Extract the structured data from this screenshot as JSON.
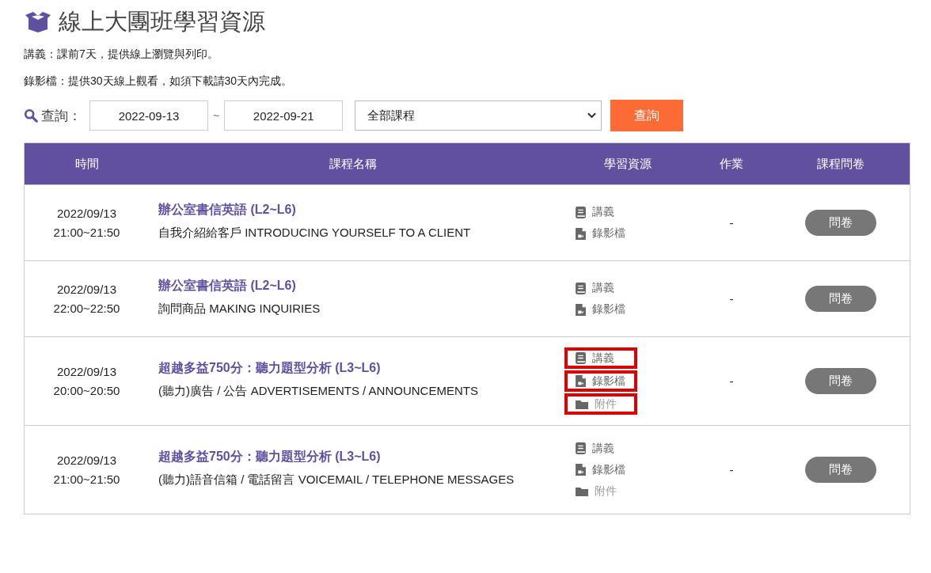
{
  "page": {
    "title": "線上大團班學習資源",
    "notes": [
      "講義：課前7天，提供線上瀏覽與列印。",
      "錄影檔：提供30天線上觀看，如須下載請30天內完成。"
    ]
  },
  "search": {
    "label": "查詢：",
    "date_from": "2022-09-13",
    "separator": "~",
    "date_to": "2022-09-21",
    "course_select": "全部課程",
    "button": "查詢"
  },
  "table": {
    "columns": [
      "時間",
      "課程名稱",
      "學習資源",
      "作業",
      "課程問卷"
    ],
    "rows": [
      {
        "date": "2022/09/13",
        "time": "21:00~21:50",
        "course": "辦公室書信英語 (L2~L6)",
        "lesson": "自我介紹給客戶 INTRODUCING YOURSELF TO A CLIENT",
        "resources": [
          {
            "kind": "handout",
            "label": "講義",
            "highlighted": false
          },
          {
            "kind": "video",
            "label": "錄影檔",
            "highlighted": false
          }
        ],
        "homework": "-",
        "survey": "問卷"
      },
      {
        "date": "2022/09/13",
        "time": "22:00~22:50",
        "course": "辦公室書信英語 (L2~L6)",
        "lesson": "詢問商品 MAKING INQUIRIES",
        "resources": [
          {
            "kind": "handout",
            "label": "講義",
            "highlighted": false
          },
          {
            "kind": "video",
            "label": "錄影檔",
            "highlighted": false
          }
        ],
        "homework": "-",
        "survey": "問卷"
      },
      {
        "date": "2022/09/13",
        "time": "20:00~20:50",
        "course": "超越多益750分：聽力題型分析 (L3~L6)",
        "lesson": "(聽力)廣告 / 公告 ADVERTISEMENTS / ANNOUNCEMENTS",
        "resources": [
          {
            "kind": "handout",
            "label": "講義",
            "highlighted": true
          },
          {
            "kind": "video",
            "label": "錄影檔",
            "highlighted": true
          },
          {
            "kind": "attachment",
            "label": "附件",
            "highlighted": true
          }
        ],
        "homework": "-",
        "survey": "問卷"
      },
      {
        "date": "2022/09/13",
        "time": "21:00~21:50",
        "course": "超越多益750分：聽力題型分析 (L3~L6)",
        "lesson": "(聽力)語音信箱 / 電話留言 VOICEMAIL / TELEPHONE MESSAGES",
        "resources": [
          {
            "kind": "handout",
            "label": "講義",
            "highlighted": false
          },
          {
            "kind": "video",
            "label": "錄影檔",
            "highlighted": false
          },
          {
            "kind": "attachment",
            "label": "附件",
            "highlighted": false
          }
        ],
        "homework": "-",
        "survey": "問卷"
      }
    ]
  }
}
